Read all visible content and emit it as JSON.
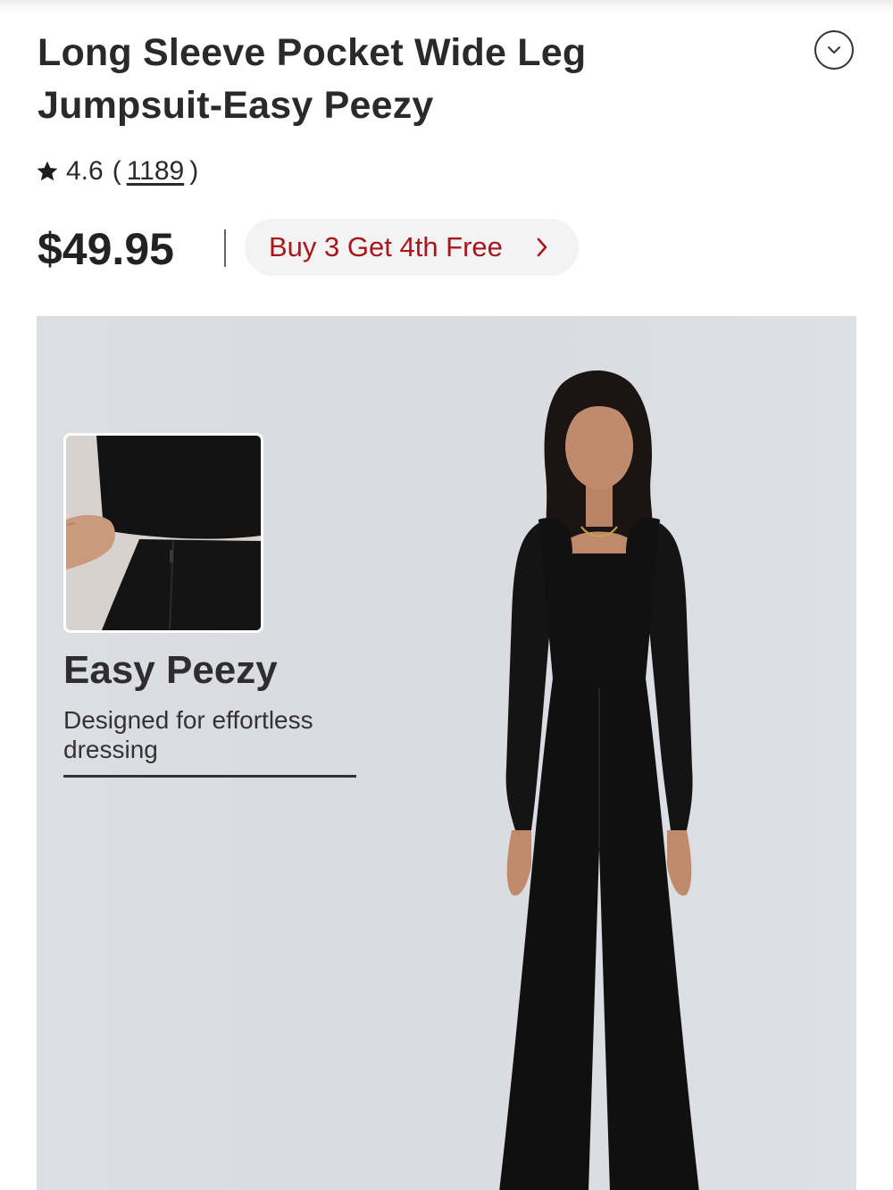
{
  "product": {
    "title": "Long Sleeve Pocket Wide Leg Jumpsuit-Easy Peezy",
    "rating": "4.6",
    "rating_open": "(",
    "review_count": "1189",
    "rating_close": ")",
    "price": "$49.95",
    "promo_label": "Buy 3 Get 4th Free"
  },
  "hero": {
    "feature_title": "Easy Peezy",
    "feature_subtitle": "Designed for effortless dressing"
  },
  "icons": {
    "expand": "chevron-down-circle-icon",
    "rating": "star-icon",
    "promo": "chevron-right-icon"
  },
  "colors": {
    "promo_text": "#a8171d",
    "hero_background": "#dcdee3",
    "garment": "#111111"
  }
}
